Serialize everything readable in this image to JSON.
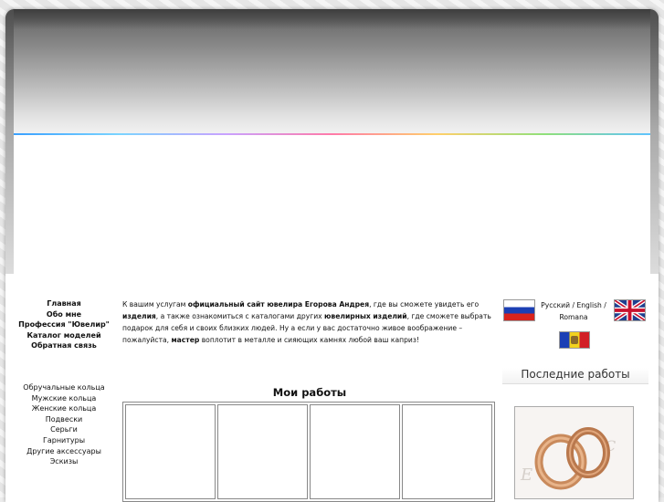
{
  "nav": {
    "main": [
      "Главная",
      "Обо мне",
      "Профессия \"Ювелир\"",
      "Каталог моделей",
      "Обратная связь"
    ],
    "catalog": [
      "Обручальные кольца",
      "Мужские кольца",
      "Женские кольца",
      "Подвески",
      "Серьги",
      "Гарнитуры",
      "Другие аксессуары",
      "Эскизы"
    ]
  },
  "intro": {
    "p1": "К вашим услугам ",
    "b1": "официальный сайт ювелира Егорова Андрея",
    "p2": ", где вы сможете увидеть его ",
    "b2": "изделия",
    "p3": ", а также ознакомиться с каталогами других ",
    "b3": "ювелирных изделий",
    "p4": ", где сможете выбрать подарок для себя и своих близких людей. Ну а если у вас достаточно живое воображение – пожалуйста, ",
    "b4": "мастер",
    "p5": " воплотит в металле и сияющих камнях любой ваш каприз!"
  },
  "languages": {
    "ru": "Русский",
    "sep": " / ",
    "en": "English",
    "sep2": " /",
    "ro": "Romana"
  },
  "works": {
    "title": "Мои работы",
    "cells": 4
  },
  "latest": {
    "title": "Последние работы"
  }
}
